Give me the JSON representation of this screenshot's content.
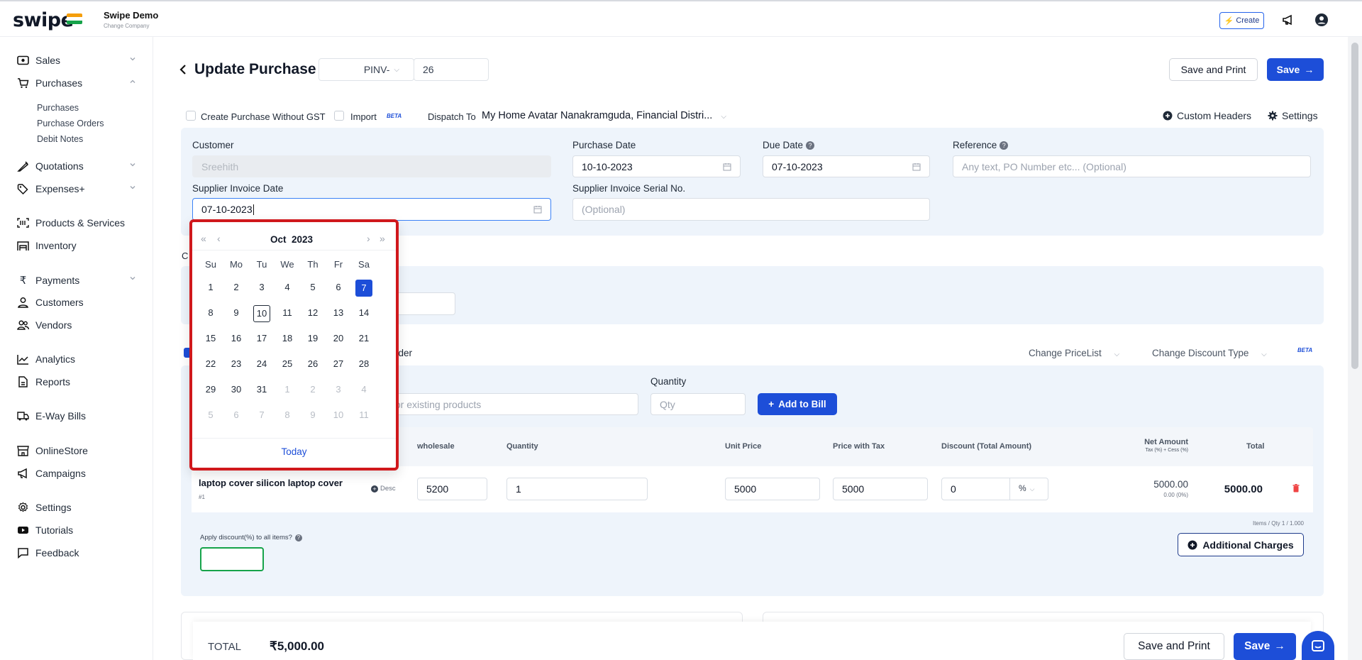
{
  "colors": {
    "accent": "#1d4ed8",
    "highlight": "#d0181c",
    "panel": "#eef4fb"
  },
  "topbar": {
    "logo": "swipe",
    "company": "Swipe Demo",
    "change_company": "Change Company",
    "create_label": "Create"
  },
  "sidebar": {
    "sales": "Sales",
    "purchases": "Purchases",
    "purchases_sub": [
      "Purchases",
      "Purchase Orders",
      "Debit Notes"
    ],
    "quotations": "Quotations",
    "expenses": "Expenses+",
    "products": "Products & Services",
    "inventory": "Inventory",
    "payments": "Payments",
    "customers": "Customers",
    "vendors": "Vendors",
    "analytics": "Analytics",
    "reports": "Reports",
    "eway": "E-Way Bills",
    "onlinestore": "OnlineStore",
    "campaigns": "Campaigns",
    "settings": "Settings",
    "tutorials": "Tutorials",
    "feedback": "Feedback"
  },
  "header": {
    "title": "Update Purchase",
    "prefix": "PINV-",
    "number": "26",
    "save_print": "Save and Print",
    "save": "Save"
  },
  "options": {
    "without_gst": "Create Purchase Without GST",
    "import": "Import",
    "beta": "BETA",
    "dispatch_label": "Dispatch To",
    "dispatch_value": "My Home Avatar Nanakramguda, Financial Distri...",
    "custom_headers": "Custom Headers",
    "settings": "Settings"
  },
  "form": {
    "customer_label": "Customer",
    "customer_value": "Sreehith",
    "purchase_date_label": "Purchase Date",
    "purchase_date": "10-10-2023",
    "due_date_label": "Due Date",
    "due_date": "07-10-2023",
    "reference_label": "Reference",
    "reference_placeholder": "Any text, PO Number etc... (Optional)",
    "supplier_date_label": "Supplier Invoice Date",
    "supplier_date": "07-10-2023",
    "supplier_serial_label": "Supplier Invoice Serial No.",
    "supplier_serial_placeholder": "(Optional)"
  },
  "calendar": {
    "month": "Oct",
    "year": "2023",
    "dow": [
      "Su",
      "Mo",
      "Tu",
      "We",
      "Th",
      "Fr",
      "Sa"
    ],
    "weeks": [
      [
        "1",
        "2",
        "3",
        "4",
        "5",
        "6",
        "7"
      ],
      [
        "8",
        "9",
        "10",
        "11",
        "12",
        "13",
        "14"
      ],
      [
        "15",
        "16",
        "17",
        "18",
        "19",
        "20",
        "21"
      ],
      [
        "22",
        "23",
        "24",
        "25",
        "26",
        "27",
        "28"
      ],
      [
        "29",
        "30",
        "31",
        "1",
        "2",
        "3",
        "4"
      ],
      [
        "5",
        "6",
        "7",
        "8",
        "9",
        "10",
        "11"
      ]
    ],
    "selected": "7",
    "today": "10",
    "today_label": "Today"
  },
  "partial": {
    "c": "C",
    "order": "rder"
  },
  "items": {
    "change_pricelist": "Change PriceList",
    "change_discount": "Change Discount Type",
    "beta": "BETA",
    "quantity_label": "Quantity",
    "search_placeholder": "for existing products",
    "qty_placeholder": "Qty",
    "add_to_bill": "Add to Bill",
    "headers": {
      "wholesale": "wholesale",
      "quantity": "Quantity",
      "unit_price": "Unit Price",
      "price_with_tax": "Price with Tax",
      "discount": "Discount (Total Amount)",
      "net_amount": "Net Amount",
      "net_sub": "Tax (%) + Cess (%)",
      "total": "Total"
    },
    "row": {
      "name": "laptop cover silicon laptop cover",
      "sub": "#1",
      "desc": "Desc",
      "wholesale": "5200",
      "quantity": "1",
      "unit_price": "5000",
      "price_with_tax": "5000",
      "discount": "0",
      "discount_type": "%",
      "net": "5000.00",
      "net_sub": "0.00 (0%)",
      "total": "5000.00"
    },
    "summary": "Items / Qty 1 / 1.000",
    "apply_discount": "Apply discount(%) to all items?",
    "additional_charges": "Additional Charges"
  },
  "footer": {
    "total_label": "TOTAL",
    "total_value": "₹5,000.00",
    "save_print": "Save and Print",
    "save": "Save"
  }
}
